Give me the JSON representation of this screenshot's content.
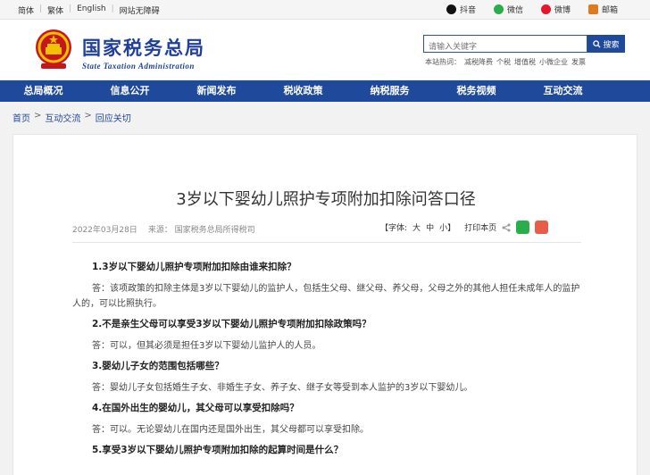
{
  "topbar": {
    "lang_simplified": "简体",
    "lang_traditional": "繁体",
    "lang_english": "English",
    "accessibility": "网站无障碍",
    "social": [
      {
        "label": "抖音",
        "icon": "douyin-icon"
      },
      {
        "label": "微信",
        "icon": "weixin-icon"
      },
      {
        "label": "微博",
        "icon": "weibo-icon"
      },
      {
        "label": "邮箱",
        "icon": "mail-icon"
      }
    ]
  },
  "header": {
    "logo_cn": "国家税务总局",
    "logo_en": "State Taxation Administration",
    "search_placeholder": "请输入关键字",
    "search_button": "搜索",
    "hotwords": [
      "本站热词：",
      "减税降费",
      "个税",
      "增值税",
      "小微企业",
      "发票"
    ]
  },
  "nav": {
    "items": [
      "总局概况",
      "信息公开",
      "新闻发布",
      "税收政策",
      "纳税服务",
      "税务视频",
      "互动交流"
    ]
  },
  "breadcrumb": [
    "首页",
    "互动交流",
    "回应关切"
  ],
  "article": {
    "title": "3岁以下婴幼儿照护专项附加扣除问答口径",
    "date": "2022年03月28日",
    "source": "来源：  国家税务总局所得税司",
    "font_label": "【字体:",
    "font_options": [
      "大",
      "中",
      "小】"
    ],
    "print": "打印本页",
    "qa": [
      {
        "q": "1.3岁以下婴幼儿照护专项附加扣除由谁来扣除？",
        "a": "答：该项政策的扣除主体是3岁以下婴幼儿的监护人，包括生父母、继父母、养父母，父母之外的其他人担任未成年人的监护人的，可以比照执行。"
      },
      {
        "q": "2.不是亲生父母可以享受3岁以下婴幼儿照护专项附加扣除政策吗？",
        "a": "答：可以，但其必须是担任3岁以下婴幼儿监护人的人员。"
      },
      {
        "q": "3.婴幼儿子女的范围包括哪些？",
        "a": "答：婴幼儿子女包括婚生子女、非婚生子女、养子女、继子女等受到本人监护的3岁以下婴幼儿。"
      },
      {
        "q": "4.在国外出生的婴幼儿，其父母可以享受扣除吗？",
        "a": "答：可以。无论婴幼儿在国内还是国外出生，其父母都可以享受扣除。"
      },
      {
        "q": "5.享受3岁以下婴幼儿照护专项附加扣除的起算时间是什么？",
        "a": ""
      }
    ]
  },
  "colors": {
    "brand_blue": "#1f4a9c",
    "logo_blue": "#1f3f9a"
  }
}
